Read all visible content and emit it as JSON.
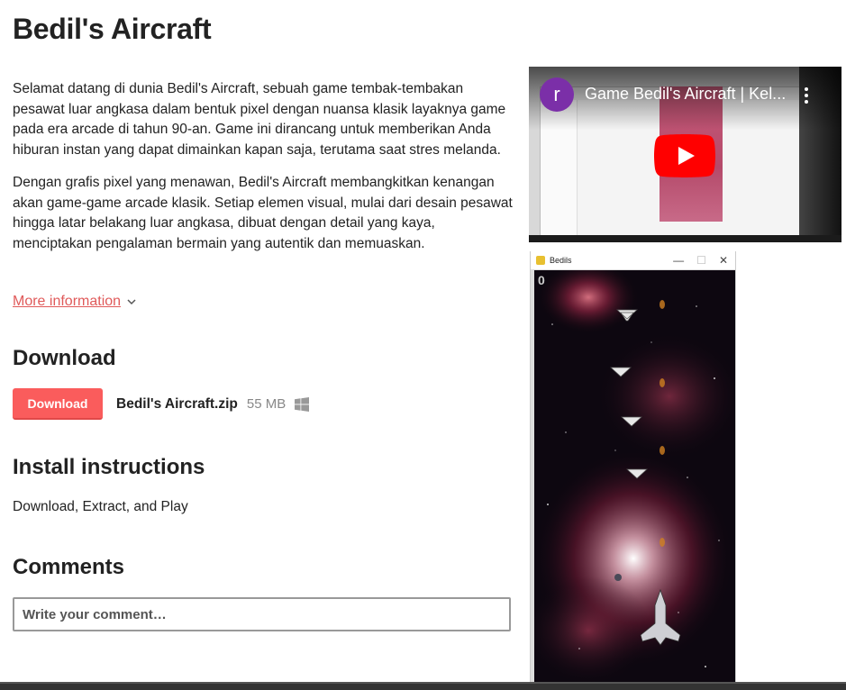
{
  "page": {
    "title": "Bedil's Aircraft"
  },
  "description": {
    "paragraphs": [
      "Selamat datang di dunia Bedil's Aircraft, sebuah game tembak-tembakan pesawat luar angkasa dalam bentuk pixel dengan nuansa klasik layaknya game pada era arcade di tahun 90-an. Game ini dirancang untuk memberikan Anda hiburan instan yang dapat dimainkan kapan saja, terutama saat stres melanda.",
      "Dengan grafis pixel yang menawan, Bedil's Aircraft membangkitkan kenangan akan game-game arcade klasik. Setiap elemen visual, mulai dari desain pesawat hingga latar belakang luar angkasa, dibuat dengan detail yang kaya, menciptakan pengalaman bermain yang autentik dan memuaskan."
    ],
    "more_info_label": "More information",
    "more_info_icon": "chevron-down-icon"
  },
  "download": {
    "heading": "Download",
    "button_label": "Download",
    "file_name": "Bedil's Aircraft.zip",
    "file_size": "55 MB",
    "platform_icon": "windows-icon"
  },
  "install": {
    "heading": "Install instructions",
    "text": "Download, Extract, and Play"
  },
  "comments": {
    "heading": "Comments",
    "placeholder": "Write your comment…"
  },
  "video": {
    "channel_initial": "r",
    "title": "Game Bedil's Aircraft | Kel...",
    "menu_icon": "more-vert-icon",
    "play_icon": "youtube-play-icon"
  },
  "screenshot": {
    "window_title": "Bedils",
    "score": "0",
    "window_buttons": [
      "—",
      "☐",
      "✕"
    ]
  },
  "colors": {
    "accent": "#fa5c5c",
    "link": "#e05a5a",
    "text": "#222222",
    "muted": "#888888",
    "youtube_red": "#ff0000",
    "avatar": "#7b2fa8"
  }
}
